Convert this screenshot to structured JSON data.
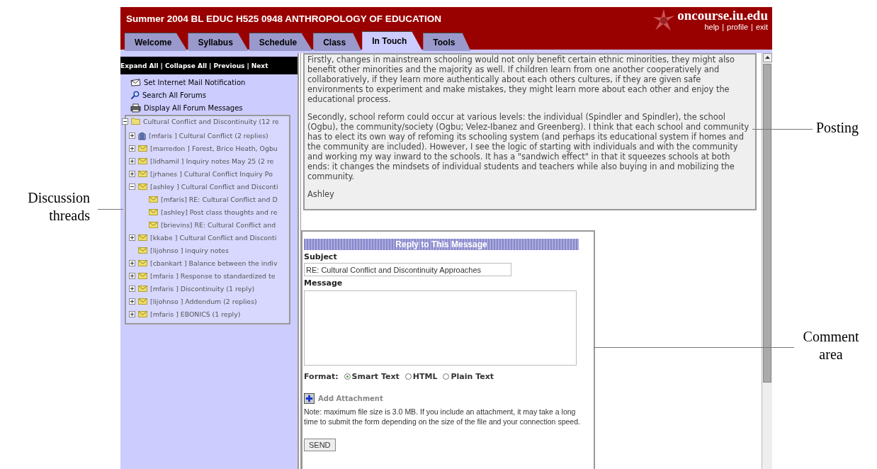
{
  "header": {
    "course_title": "Summer 2004 BL EDUC H525 0948 ANTHROPOLOGY OF EDUCATION",
    "site_name": "oncourse.iu.edu",
    "links": [
      "help",
      "profile",
      "exit"
    ],
    "link_separator": "|"
  },
  "tabs": [
    {
      "label": "Welcome",
      "selected": false
    },
    {
      "label": "Syllabus",
      "selected": false
    },
    {
      "label": "Schedule",
      "selected": false
    },
    {
      "label": "Class",
      "selected": false
    },
    {
      "label": "In Touch",
      "selected": true
    },
    {
      "label": "Tools",
      "selected": false
    }
  ],
  "sidebar": {
    "nav_links": [
      "Expand All",
      "Collapse All",
      "Previous",
      "Next"
    ],
    "nav_separator": "|",
    "actions": [
      {
        "kind": "mail",
        "label": "Set Internet Mail Notification"
      },
      {
        "kind": "search",
        "label": "Search All Forums"
      },
      {
        "kind": "print",
        "label": "Display All Forum Messages"
      }
    ],
    "forum": {
      "label": "Cultural Conflict and Discontinuity (12 re",
      "expanded": true,
      "children": [
        {
          "kind": "locked",
          "label": "[mfaris ] Cultural Conflict (2 replies)",
          "expanded": false
        },
        {
          "kind": "mail",
          "label": "[marredon ] Forest, Brice Heath, Ogbu",
          "expanded": false
        },
        {
          "kind": "mail",
          "label": "[lidhamil ] Inquiry notes May 25 (2 re",
          "expanded": false
        },
        {
          "kind": "mail",
          "label": "[jrhanes ] Cultural Conflict Inquiry Po",
          "expanded": false
        },
        {
          "kind": "mail",
          "label": "[ashley ] Cultural Conflict and Disconti",
          "expanded": true,
          "children": [
            {
              "kind": "mail",
              "label": "[mfaris] RE: Cultural Conflict and D"
            },
            {
              "kind": "mail",
              "label": "[ashley] Post class thoughts and re"
            },
            {
              "kind": "mail",
              "label": "[brievins] RE: Cultural Conflict and"
            }
          ]
        },
        {
          "kind": "mail",
          "label": "[kkabe ] Cultural Conflict and Disconti",
          "expanded": false
        },
        {
          "kind": "mail",
          "label": "[lijohnso ] inquiry notes"
        },
        {
          "kind": "mail",
          "label": "[cbankart ] Balance between the indiv",
          "expanded": false
        },
        {
          "kind": "mail",
          "label": "[mfaris ] Response to standardized te",
          "expanded": false
        },
        {
          "kind": "mail",
          "label": "[mfaris ] Discontinuity (1 reply)",
          "expanded": false
        },
        {
          "kind": "mail",
          "label": "[lijohnso ] Addendum (2 replies)",
          "expanded": false
        },
        {
          "kind": "mail",
          "label": "[mfaris ] EBONICS (1 reply)",
          "expanded": false
        }
      ]
    }
  },
  "posting": {
    "paragraphs": [
      "Firstly, changes in mainstream schooling would not only benefit certain ethnic minorities, they might also benefit other minorities and the majority as well. If children learn from one another cooperatively and collaboratively, if they learn more authentically about each others cultures, if they are given safe environments to experiment and make mistakes, they might learn more about each other and enjoy the educational process.",
      "Secondly, school reform could occur at various levels: the individual (Spindler and Spindler), the school (Ogbu), the community/society (Ogbu; Velez-Ibanez and Greenberg). I think that each school and community has to elect its own way of refoming its schooling system (and perhaps its educational system if homes and the community are included). However, I see the logic of starting with individuals and with the community and working my way inward to the schools. It has a \"sandwich effect\" in that it squeezes schools at both ends: it changes the mindsets of individual students and teachers while also buying in and mobilizing the community.",
      "Ashley"
    ]
  },
  "reply_form": {
    "title": "Reply to This Message",
    "subject_label": "Subject",
    "subject_value": "RE: Cultural Conflict and Discontinuity Approaches",
    "message_label": "Message",
    "format_label": "Format:",
    "formats": [
      {
        "label": "Smart Text",
        "selected": true
      },
      {
        "label": "HTML",
        "selected": false
      },
      {
        "label": "Plain Text",
        "selected": false
      }
    ],
    "attachment_label": "Add Attachment",
    "note": "Note: maximum file size is 3.0 MB. If you include an attachment, it may take a long time to submit the form depending on the size of the file and your connection speed.",
    "send_label": "SEND"
  },
  "annotations": {
    "left": "Discussion threads",
    "right": [
      {
        "text": "Posting"
      },
      {
        "text": "Comment area"
      }
    ]
  }
}
